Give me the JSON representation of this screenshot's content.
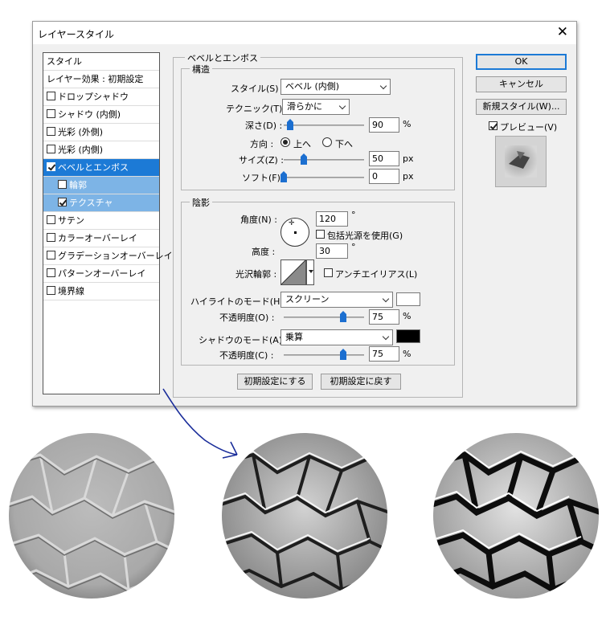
{
  "dialog": {
    "title": "レイヤースタイル",
    "close_icon": "close-icon"
  },
  "style_list": {
    "header": "スタイル",
    "blending": "レイヤー効果 : 初期設定",
    "items": [
      {
        "label": "ドロップシャドウ",
        "checked": false,
        "state": "normal"
      },
      {
        "label": "シャドウ (内側)",
        "checked": false,
        "state": "normal"
      },
      {
        "label": "光彩 (外側)",
        "checked": false,
        "state": "normal"
      },
      {
        "label": "光彩 (内側)",
        "checked": false,
        "state": "normal"
      },
      {
        "label": "ベベルとエンボス",
        "checked": true,
        "state": "selected"
      },
      {
        "label": "輪郭",
        "checked": false,
        "state": "sub"
      },
      {
        "label": "テクスチャ",
        "checked": true,
        "state": "sub"
      },
      {
        "label": "サテン",
        "checked": false,
        "state": "normal"
      },
      {
        "label": "カラーオーバーレイ",
        "checked": false,
        "state": "normal"
      },
      {
        "label": "グラデーションオーバーレイ",
        "checked": false,
        "state": "normal"
      },
      {
        "label": "パターンオーバーレイ",
        "checked": false,
        "state": "normal"
      },
      {
        "label": "境界線",
        "checked": false,
        "state": "normal"
      }
    ]
  },
  "bevel": {
    "group_title": "ベベルとエンボス",
    "structure_title": "構造",
    "style_label": "スタイル(S) :",
    "style_value": "ベベル (内側)",
    "technique_label": "テクニック(T) :",
    "technique_value": "滑らかに",
    "depth_label": "深さ(D) :",
    "depth_value": "90",
    "depth_unit": "%",
    "direction_label": "方向 :",
    "direction_up": "上へ",
    "direction_down": "下へ",
    "size_label": "サイズ(Z) :",
    "size_value": "50",
    "size_unit": "px",
    "soften_label": "ソフト(F) :",
    "soften_value": "0",
    "soften_unit": "px"
  },
  "shading": {
    "title": "陰影",
    "angle_label": "角度(N) :",
    "angle_value": "120",
    "angle_unit": "°",
    "global_light_label": "包括光源を使用(G)",
    "altitude_label": "高度 :",
    "altitude_value": "30",
    "altitude_unit": "°",
    "gloss_label": "光沢輪郭 :",
    "antialias_label": "アンチエイリアス(L)",
    "highlight_mode_label": "ハイライトのモード(H) :",
    "highlight_mode_value": "スクリーン",
    "highlight_color": "#ffffff",
    "highlight_opacity_label": "不透明度(O) :",
    "highlight_opacity_value": "75",
    "shadow_mode_label": "シャドウのモード(A) :",
    "shadow_mode_value": "乗算",
    "shadow_color": "#000000",
    "shadow_opacity_label": "不透明度(C) :",
    "shadow_opacity_value": "75",
    "percent": "%"
  },
  "footer": {
    "make_default": "初期設定にする",
    "reset_default": "初期設定に戻す"
  },
  "right": {
    "ok": "OK",
    "cancel": "キャンセル",
    "new_style": "新規スタイル(W)...",
    "preview_label": "プレビュー(V)"
  },
  "accent_color": "#1c7ad6"
}
